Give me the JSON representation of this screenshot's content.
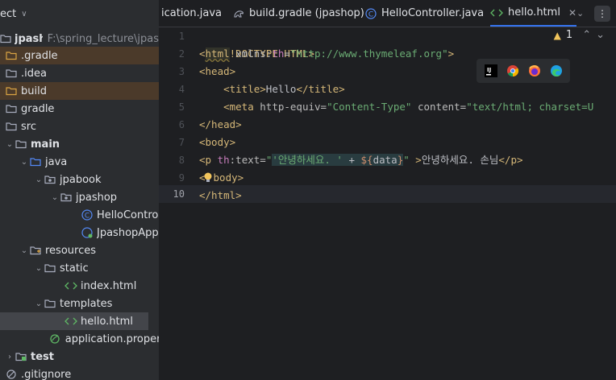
{
  "sidebar": {
    "header": "ect",
    "items": [
      {
        "label": "jpashop",
        "path": "F:\\spring_lecture\\jpas"
      },
      {
        "label": ".gradle"
      },
      {
        "label": ".idea"
      },
      {
        "label": "build"
      },
      {
        "label": "gradle"
      },
      {
        "label": "src"
      },
      {
        "label": "main"
      },
      {
        "label": "java"
      },
      {
        "label": "jpabook"
      },
      {
        "label": "jpashop"
      },
      {
        "label": "HelloContro"
      },
      {
        "label": "JpashopApp"
      },
      {
        "label": "resources"
      },
      {
        "label": "static"
      },
      {
        "label": "index.html"
      },
      {
        "label": "templates"
      },
      {
        "label": "hello.html"
      },
      {
        "label": "application.proper"
      },
      {
        "label": "test"
      },
      {
        "label": ".gitignore"
      }
    ]
  },
  "tabs": [
    {
      "label": "ication.java"
    },
    {
      "label": "build.gradle (jpashop)"
    },
    {
      "label": "HelloController.java"
    },
    {
      "label": "hello.html"
    }
  ],
  "editor": {
    "line_numbers": [
      "1",
      "2",
      "3",
      "4",
      "5",
      "6",
      "7",
      "8",
      "9",
      "10"
    ],
    "warnings": "1",
    "lines": {
      "l1": "<!DOCTYPE HTML>",
      "l2_open": "<",
      "l2_tag": "html",
      "l2_attr": " xmlns:",
      "l2_ns": "th",
      "l2_eq": "=",
      "l2_str": "\"http://www.thymeleaf.org\"",
      "l2_close": ">",
      "l3": "<head>",
      "l4_indent": "    ",
      "l4_open": "<title>",
      "l4_text": "Hello",
      "l4_close": "</title>",
      "l5_indent": "    ",
      "l5_tag": "<meta",
      "l5_attr1": " http-equiv",
      "l5_eq1": "=",
      "l5_str1": "\"Content-Type\"",
      "l5_attr2": " content",
      "l5_eq2": "=",
      "l5_str2": "\"text/html; charset=U",
      "l6": "</head>",
      "l7": "<body>",
      "l8_tag": "<p",
      "l8_ns": " th",
      "l8_attr": ":text",
      "l8_eq": "=",
      "l8_q1": "\"",
      "l8_expr_str": "'안녕하세요. '",
      "l8_plus": " + ",
      "l8_expr": "${",
      "l8_var": "data",
      "l8_expr_end": "}",
      "l8_q2": "\"",
      "l8_gt": " >",
      "l8_text": "안녕하세요. 손님",
      "l8_close": "</p>",
      "l9_a": "<",
      "l9_b": "body>",
      "l10": "</html>"
    }
  },
  "colors": {
    "tag": "#d5b778",
    "string": "#6aab73",
    "namespace": "#c77dbb",
    "accent": "#3574f0"
  },
  "icons": {
    "browser_popup": [
      "intellij-icon",
      "chrome-icon",
      "firefox-icon",
      "edge-icon"
    ]
  }
}
